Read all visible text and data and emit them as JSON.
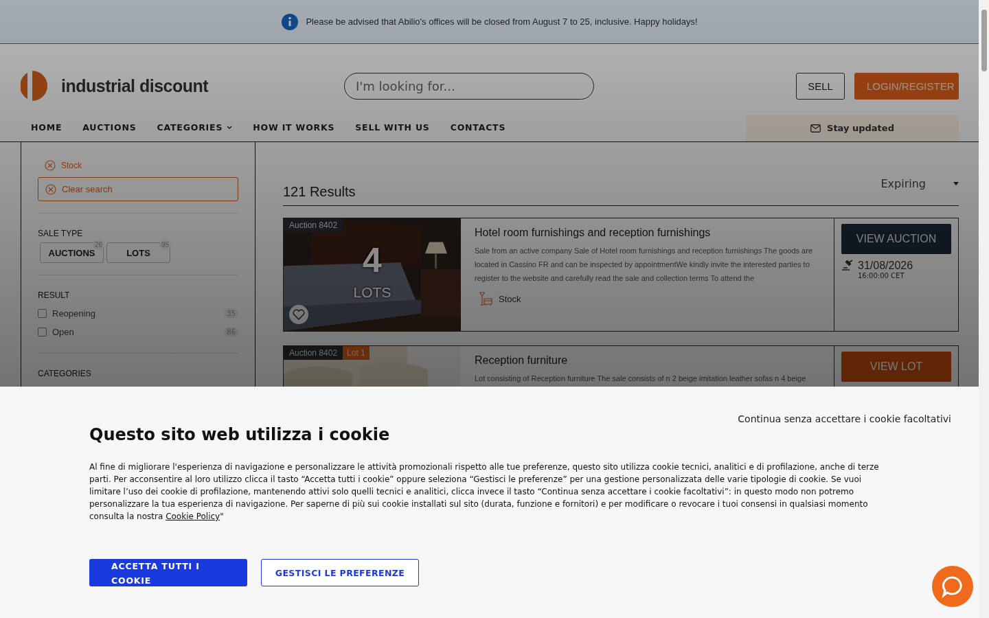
{
  "notice": {
    "text": "Please be advised that Abilio's offices will be closed from August 7 to 25, inclusive. Happy holidays!"
  },
  "header": {
    "logo_text": "industrial discount",
    "search": {
      "placeholder": "I'm looking for..."
    },
    "buttons": [
      {
        "label": "SELL",
        "kind": "outline"
      },
      {
        "label": "LOGIN/REGISTER",
        "kind": "primary"
      }
    ]
  },
  "nav": {
    "items": [
      {
        "label": "HOME",
        "dropdown": false
      },
      {
        "label": "AUCTIONS",
        "dropdown": false
      },
      {
        "label": "CATEGORIES",
        "dropdown": true
      },
      {
        "label": "HOW IT WORKS",
        "dropdown": false
      },
      {
        "label": "SELL WITH US",
        "dropdown": false
      },
      {
        "label": "CONTACTS",
        "dropdown": false
      }
    ],
    "stay_updated": "Stay updated"
  },
  "sidebar": {
    "active_filters": [
      {
        "label": "Stock"
      }
    ],
    "clear_search": "Clear search",
    "sale_type": {
      "title": "SALE TYPE",
      "options": [
        {
          "label": "AUCTIONS",
          "count": "26"
        },
        {
          "label": "LOTS",
          "count": "95"
        }
      ]
    },
    "result": {
      "title": "RESULT",
      "options": [
        {
          "label": "Reopening",
          "count": "35",
          "checked": false
        },
        {
          "label": "Open",
          "count": "86",
          "checked": false
        }
      ]
    },
    "categories_title": "CATEGORIES"
  },
  "results": {
    "count": "121 Results",
    "sort": "Expiring",
    "cards": [
      {
        "kind": "auction",
        "auction_tag": "Auction 8402",
        "big_number": "4",
        "big_label": "LOTS",
        "title": "Hotel room furnishings and reception furnishings",
        "description": "Sale from an active company Sale of Hotel room furnishings and reception furnishings The goods are located in Cassino FR and can be inspected by appointmentWe kindly invite the interested parties to register to the website and carefully read the sale and collection terms To attend the",
        "category": "Stock",
        "button": "VIEW AUCTION",
        "date": "31/08/2026",
        "time": "16:00:00 CET"
      },
      {
        "kind": "lot",
        "auction_tag": "Auction 8402",
        "lot_tag": "Lot 1",
        "title": "Reception furniture",
        "description": "Lot consisting of Reception furniture The sale consists of n 2 beige imitation leather sofas n 4 beige",
        "button": "VIEW LOT"
      }
    ]
  },
  "cookie": {
    "dismiss": "Continua senza accettare i cookie facoltativi",
    "title": "Questo sito web utilizza i cookie",
    "text": "Al fine di migliorare l'esperienza di navigazione e personalizzare le attività promozionali rispetto alle tue preferenze, questo sito utilizza cookie tecnici, analitici e di profilazione, anche di terze parti. Per acconsentire al loro utilizzo clicca il tasto “Accetta tutti i cookie” oppure seleziona “Gestisci le preferenze” per una gestione personalizzata delle varie tipologie di cookie. Se vuoi limitare l’uso dei cookie di profilazione, mantenendo attivi solo quelli tecnici e analitici, clicca invece il tasto “Continua senza accettare i cookie facoltativi”: in questo modo non potremo personalizzare la tua esperienza di navigazione. Per saperne di più sui cookie installati sul sito (durata, funzione e fornitori) e per modificare o revocare i tuoi consensi in qualsiasi momento consulta la nostra",
    "link": "Cookie Policy",
    "text_after": "\"",
    "accept": "ACCETTA TUTTI I COOKIE",
    "manage": "GESTISCI LE PREFERENZE"
  }
}
